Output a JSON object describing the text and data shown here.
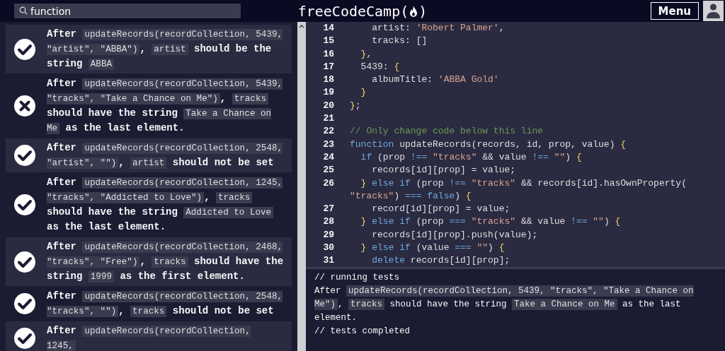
{
  "header": {
    "search": {
      "value": "function"
    },
    "logo": {
      "before": "freeCodeCamp(",
      "after": ")"
    },
    "menu_button": "Menu"
  },
  "tests": [
    {
      "passed": true,
      "parts": [
        {
          "kind": "text",
          "text": "After "
        },
        {
          "kind": "code",
          "text": "updateRecords(recordCollection, 5439, \"artist\", \"ABBA\")"
        },
        {
          "kind": "text",
          "text": ", "
        },
        {
          "kind": "code",
          "text": "artist"
        },
        {
          "kind": "text",
          "text": " should be the string "
        },
        {
          "kind": "code",
          "text": "ABBA"
        }
      ]
    },
    {
      "passed": false,
      "parts": [
        {
          "kind": "text",
          "text": "After "
        },
        {
          "kind": "code",
          "text": "updateRecords(recordCollection, 5439, \"tracks\", \"Take a Chance on Me\")"
        },
        {
          "kind": "text",
          "text": ", "
        },
        {
          "kind": "code",
          "text": "tracks"
        },
        {
          "kind": "text",
          "text": " should have the string "
        },
        {
          "kind": "code",
          "text": "Take a Chance on Me"
        },
        {
          "kind": "text",
          "text": " as the last element."
        }
      ]
    },
    {
      "passed": true,
      "parts": [
        {
          "kind": "text",
          "text": "After "
        },
        {
          "kind": "code",
          "text": "updateRecords(recordCollection, 2548, \"artist\", \"\")"
        },
        {
          "kind": "text",
          "text": ", "
        },
        {
          "kind": "code",
          "text": "artist"
        },
        {
          "kind": "text",
          "text": " should not be set"
        }
      ]
    },
    {
      "passed": true,
      "parts": [
        {
          "kind": "text",
          "text": "After "
        },
        {
          "kind": "code",
          "text": "updateRecords(recordCollection, 1245, \"tracks\", \"Addicted to Love\")"
        },
        {
          "kind": "text",
          "text": ", "
        },
        {
          "kind": "code",
          "text": "tracks"
        },
        {
          "kind": "text",
          "text": " should have the string "
        },
        {
          "kind": "code",
          "text": "Addicted to Love"
        },
        {
          "kind": "text",
          "text": " as the last element."
        }
      ]
    },
    {
      "passed": true,
      "parts": [
        {
          "kind": "text",
          "text": "After "
        },
        {
          "kind": "code",
          "text": "updateRecords(recordCollection, 2468, \"tracks\", \"Free\")"
        },
        {
          "kind": "text",
          "text": ", "
        },
        {
          "kind": "code",
          "text": "tracks"
        },
        {
          "kind": "text",
          "text": " should have the string "
        },
        {
          "kind": "code",
          "text": "1999"
        },
        {
          "kind": "text",
          "text": " as the first element."
        }
      ]
    },
    {
      "passed": true,
      "parts": [
        {
          "kind": "text",
          "text": "After "
        },
        {
          "kind": "code",
          "text": "updateRecords(recordCollection, 2548, \"tracks\", \"\")"
        },
        {
          "kind": "text",
          "text": ", "
        },
        {
          "kind": "code",
          "text": "tracks"
        },
        {
          "kind": "text",
          "text": " should not be set"
        }
      ]
    },
    {
      "passed": true,
      "parts": [
        {
          "kind": "text",
          "text": "After "
        },
        {
          "kind": "code",
          "text": "updateRecords(recordCollection, 1245,"
        }
      ]
    }
  ],
  "editor": {
    "lines": [
      {
        "number": "14",
        "tokens": [
          {
            "kind": "plain",
            "text": "    artist: "
          },
          {
            "kind": "string",
            "text": "'Robert Palmer'"
          },
          {
            "kind": "plain",
            "text": ","
          }
        ]
      },
      {
        "number": "15",
        "tokens": [
          {
            "kind": "plain",
            "text": "    tracks: []"
          }
        ]
      },
      {
        "number": "16",
        "tokens": [
          {
            "kind": "brace",
            "text": "  }"
          },
          {
            "kind": "plain",
            "text": ","
          }
        ]
      },
      {
        "number": "17",
        "tokens": [
          {
            "kind": "plain",
            "text": "  5439: "
          },
          {
            "kind": "brace",
            "text": "{"
          }
        ]
      },
      {
        "number": "18",
        "tokens": [
          {
            "kind": "plain",
            "text": "    albumTitle: "
          },
          {
            "kind": "string",
            "text": "'ABBA Gold'"
          }
        ]
      },
      {
        "number": "19",
        "tokens": [
          {
            "kind": "brace",
            "text": "  }"
          }
        ]
      },
      {
        "number": "20",
        "tokens": [
          {
            "kind": "brace",
            "text": "}"
          },
          {
            "kind": "plain",
            "text": ";"
          }
        ]
      },
      {
        "number": "21"
      },
      {
        "number": "22",
        "tokens": [
          {
            "kind": "comment",
            "text": "// Only change code below this line"
          }
        ]
      },
      {
        "number": "23",
        "tokens": [
          {
            "kind": "keyword",
            "text": "function"
          },
          {
            "kind": "plain",
            "text": " updateRecords(records, id, prop, value) "
          },
          {
            "kind": "brace",
            "text": "{"
          }
        ]
      },
      {
        "number": "24",
        "tokens": [
          {
            "kind": "keyword",
            "text": "  if"
          },
          {
            "kind": "plain",
            "text": " (prop "
          },
          {
            "kind": "keyword",
            "text": "!=="
          },
          {
            "kind": "string",
            "text": " \"tracks\""
          },
          {
            "kind": "plain",
            "text": " && value "
          },
          {
            "kind": "keyword",
            "text": "!=="
          },
          {
            "kind": "string",
            "text": " \"\""
          },
          {
            "kind": "plain",
            "text": ") "
          },
          {
            "kind": "brace",
            "text": "{"
          }
        ]
      },
      {
        "number": "25",
        "tokens": [
          {
            "kind": "plain",
            "text": "    records[id][prop] = value;"
          }
        ]
      },
      {
        "number": "26",
        "tokens": [
          {
            "kind": "brace",
            "text": "  }"
          },
          {
            "kind": "keyword",
            "text": " else if"
          },
          {
            "kind": "plain",
            "text": " (prop "
          },
          {
            "kind": "keyword",
            "text": "!=="
          },
          {
            "kind": "string",
            "text": " \"tracks\""
          },
          {
            "kind": "plain",
            "text": " && records[id].hasOwnProperty"
          },
          {
            "kind": "plain",
            "text": "("
          },
          {
            "kind": "string",
            "text": "\"tracks\""
          },
          {
            "kind": "plain",
            "text": ") "
          },
          {
            "kind": "keyword",
            "text": "==="
          },
          {
            "kind": "keyword",
            "text": " false"
          },
          {
            "kind": "plain",
            "text": ") "
          },
          {
            "kind": "brace",
            "text": "{"
          }
        ]
      },
      {
        "number": "27",
        "tokens": [
          {
            "kind": "plain",
            "text": "    record[id][prop] = value;"
          }
        ]
      },
      {
        "number": "28",
        "tokens": [
          {
            "kind": "brace",
            "text": "  }"
          },
          {
            "kind": "keyword",
            "text": " else if"
          },
          {
            "kind": "plain",
            "text": " (prop "
          },
          {
            "kind": "keyword",
            "text": "==="
          },
          {
            "kind": "string",
            "text": " \"tracks\""
          },
          {
            "kind": "plain",
            "text": " && value "
          },
          {
            "kind": "keyword",
            "text": "!=="
          },
          {
            "kind": "string",
            "text": " \"\""
          },
          {
            "kind": "plain",
            "text": ") "
          },
          {
            "kind": "brace",
            "text": "{"
          }
        ]
      },
      {
        "number": "29",
        "tokens": [
          {
            "kind": "plain",
            "text": "    records[id][prop].push(value);"
          }
        ]
      },
      {
        "number": "30",
        "tokens": [
          {
            "kind": "brace",
            "text": "  }"
          },
          {
            "kind": "keyword",
            "text": " else if"
          },
          {
            "kind": "plain",
            "text": " (value "
          },
          {
            "kind": "keyword",
            "text": "==="
          },
          {
            "kind": "string",
            "text": " \"\""
          },
          {
            "kind": "plain",
            "text": ") "
          },
          {
            "kind": "brace",
            "text": "{"
          }
        ]
      },
      {
        "number": "31",
        "tokens": [
          {
            "kind": "keyword",
            "text": "    delete"
          },
          {
            "kind": "plain",
            "text": " records[id][prop];"
          }
        ]
      }
    ]
  },
  "console": {
    "lines": [
      {
        "parts": [
          {
            "kind": "text",
            "text": "// running tests"
          }
        ]
      },
      {
        "parts": [
          {
            "kind": "text",
            "text": "After "
          },
          {
            "kind": "code",
            "text": "updateRecords(recordCollection, 5439, \"tracks\", \"Take a Chance on Me\")"
          },
          {
            "kind": "text",
            "text": ", "
          },
          {
            "kind": "code",
            "text": "tracks"
          },
          {
            "kind": "text",
            "text": " should have the string "
          },
          {
            "kind": "code",
            "text": "Take a Chance on Me"
          },
          {
            "kind": "text",
            "text": " as the last element."
          }
        ]
      },
      {
        "parts": [
          {
            "kind": "text",
            "text": "// tests completed"
          }
        ]
      }
    ]
  }
}
